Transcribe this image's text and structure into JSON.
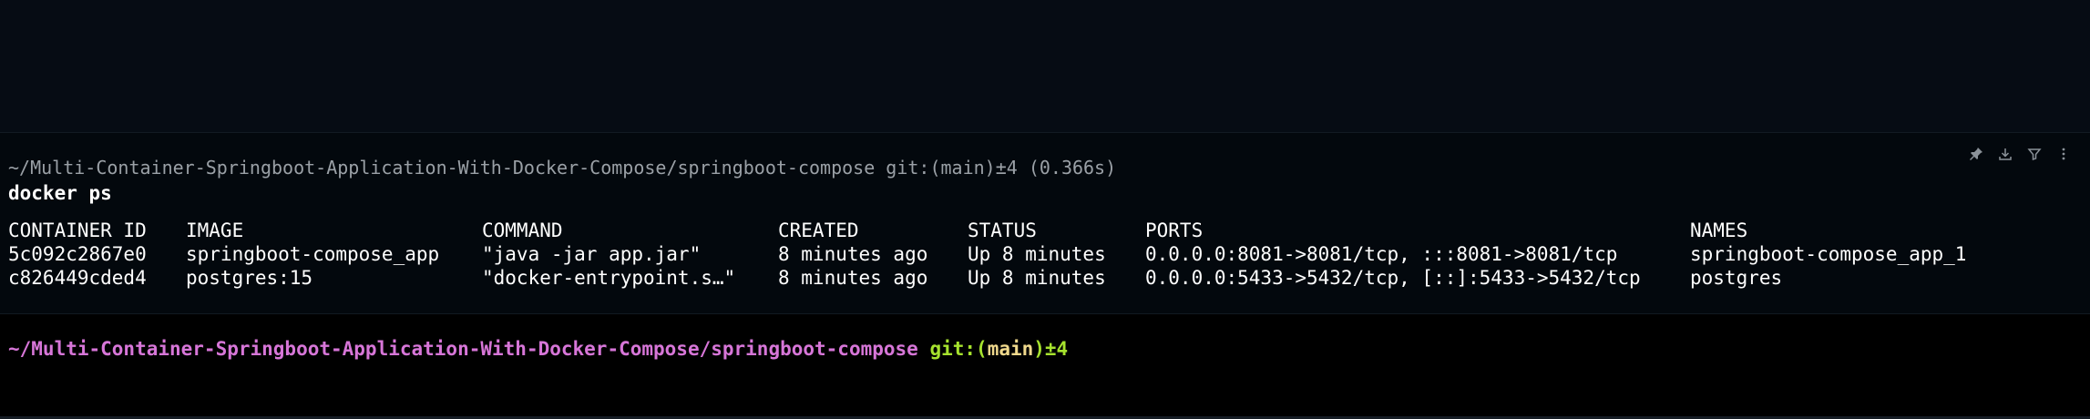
{
  "previous_block": {
    "prompt": "~/Multi-Container-Springboot-Application-With-Docker-Compose/springboot-compose git:(main)±4 (0.366s)",
    "command": "docker ps",
    "toolbar": {
      "icons": [
        "pin-icon",
        "download-icon",
        "filter-icon",
        "more-icon"
      ]
    },
    "table": {
      "headers": [
        "CONTAINER ID",
        "IMAGE",
        "COMMAND",
        "CREATED",
        "STATUS",
        "PORTS",
        "NAMES"
      ],
      "rows": [
        [
          "5c092c2867e0",
          "springboot-compose_app",
          "\"java -jar app.jar\"",
          "8 minutes ago",
          "Up 8 minutes",
          "0.0.0.0:8081->8081/tcp, :::8081->8081/tcp",
          "springboot-compose_app_1"
        ],
        [
          "c826449cded4",
          "postgres:15",
          "\"docker-entrypoint.s…\"",
          "8 minutes ago",
          "Up 8 minutes",
          "0.0.0.0:5433->5432/tcp, [::]:5433->5432/tcp",
          "postgres"
        ]
      ]
    }
  },
  "active_prompt": {
    "path": "~/Multi-Container-Springboot-Application-With-Docker-Compose/springboot-compose",
    "git_prefix": "git:(",
    "branch": "main",
    "git_suffix": ")±4"
  },
  "colors": {
    "background": "#03080d",
    "prompt_path": "#d776d8",
    "git": "#a6e22e",
    "branch": "#f0d98c",
    "muted": "#9aa0a6"
  }
}
